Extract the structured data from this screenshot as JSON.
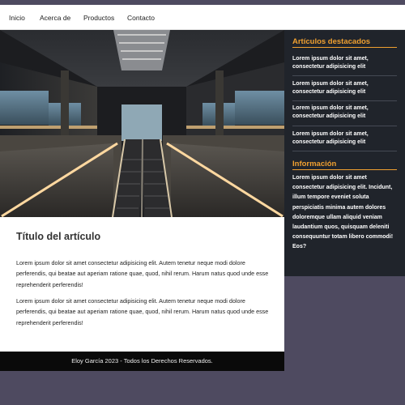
{
  "nav": {
    "items": [
      "Inicio",
      "Acerca de",
      "Productos",
      "Contacto"
    ]
  },
  "hero": {
    "image": "escalator-station-photo"
  },
  "article": {
    "title": "Título del artículo",
    "paragraphs": [
      "Lorem ipsum dolor sit amet consectetur adipisicing elit. Autem tenetur neque modi dolore perferendis, qui beatae aut aperiam ratione quae, quod, nihil rerum. Harum natus quod unde esse reprehenderit perferendis!",
      "Lorem ipsum dolor sit amet consectetur adipisicing elit. Autem tenetur neque modi dolore perferendis, qui beatae aut aperiam ratione quae, quod, nihil rerum. Harum natus quod unde esse reprehenderit perferendis!"
    ]
  },
  "footer": {
    "text": "Eloy García 2023 - Todos los Derechos Reservados."
  },
  "sidebar": {
    "featured_title": "Artículos destacados",
    "featured_items": [
      "Lorem ipsum dolor sit amet, consectetur adipisicing elit",
      "Lorem ipsum dolor sit amet, consectetur adipisicing elit",
      "Lorem ipsum dolor sit amet, consectetur adipisicing elit",
      "Lorem ipsum dolor sit amet, consectetur adipisicing elit"
    ],
    "info_title": "Información",
    "info_text": "Lorem ipsum dolor sit amet consectetur adipisicing elit. Incidunt, illum tempore eveniet soluta perspiciatis minima autem dolores doloremque ullam aliquid veniam laudantium quos, quisquam deleniti consequuntur totam libero commodi! Eos?"
  },
  "colors": {
    "page_bg": "#4e4a60",
    "sidebar_bg": "#20242b",
    "accent": "#f0a030",
    "footer_bg": "#0a0a0a"
  }
}
